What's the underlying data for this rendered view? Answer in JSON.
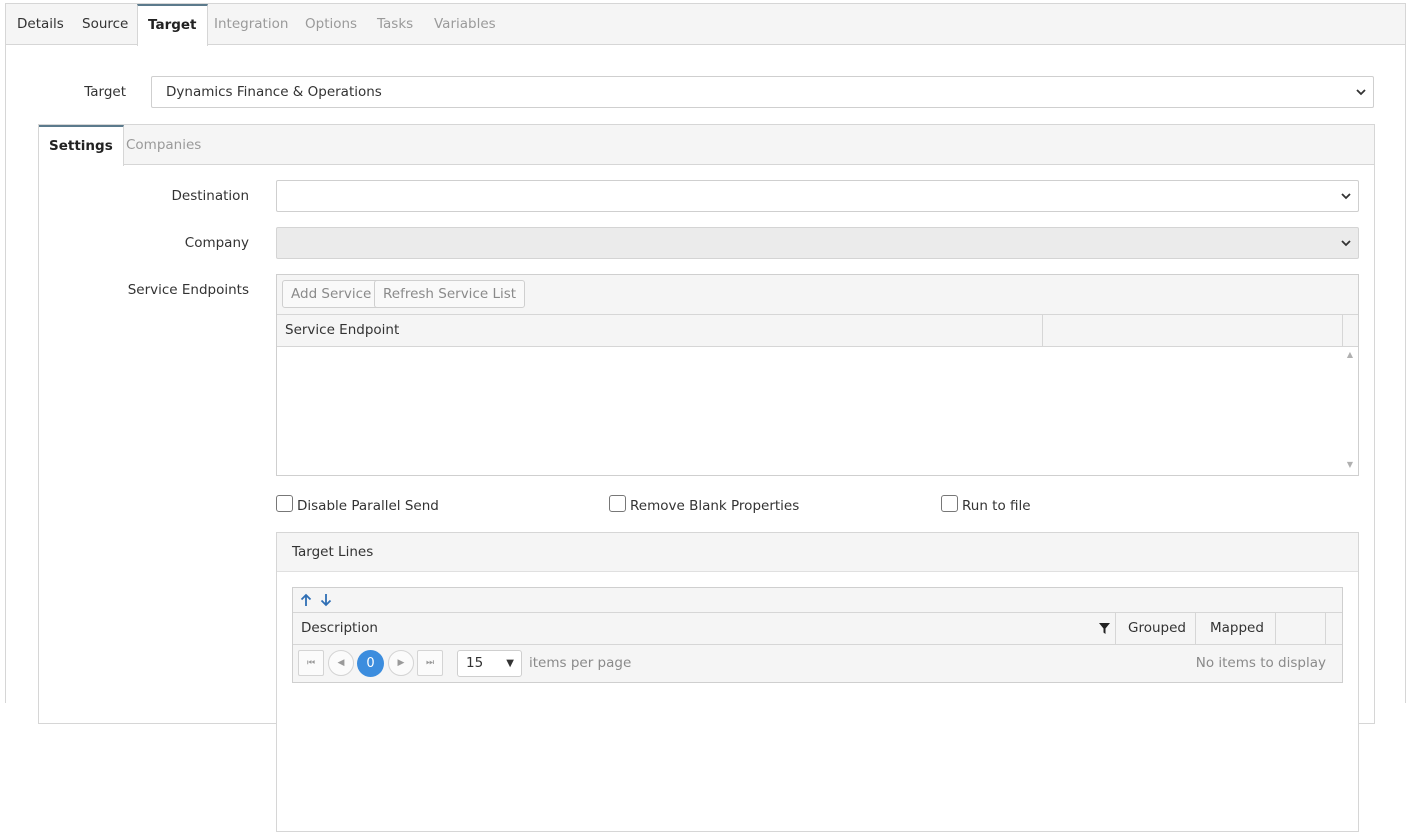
{
  "top_tabs": [
    {
      "label": "Details",
      "state": "normal"
    },
    {
      "label": "Source",
      "state": "normal"
    },
    {
      "label": "Target",
      "state": "active"
    },
    {
      "label": "Integration",
      "state": "muted"
    },
    {
      "label": "Options",
      "state": "muted"
    },
    {
      "label": "Tasks",
      "state": "muted"
    },
    {
      "label": "Variables",
      "state": "muted"
    }
  ],
  "target": {
    "label": "Target",
    "value": "Dynamics Finance & Operations"
  },
  "inner_tabs": [
    {
      "label": "Settings",
      "state": "active"
    },
    {
      "label": "Companies",
      "state": "muted"
    }
  ],
  "destination": {
    "label": "Destination",
    "value": ""
  },
  "company": {
    "label": "Company",
    "value": ""
  },
  "service_endpoints": {
    "label": "Service Endpoints",
    "add_button": "Add Service",
    "refresh_button": "Refresh Service List",
    "columns": [
      "Service Endpoint",
      ""
    ]
  },
  "options": {
    "disable_parallel_send": {
      "label": "Disable Parallel Send",
      "checked": false
    },
    "remove_blank_properties": {
      "label": "Remove Blank Properties",
      "checked": false
    },
    "run_to_file": {
      "label": "Run to file",
      "checked": false
    }
  },
  "target_lines": {
    "title": "Target Lines",
    "columns": {
      "description": "Description",
      "grouped": "Grouped",
      "mapped": "Mapped"
    },
    "pager": {
      "current_page": "0",
      "page_size": "15",
      "per_page_label": "items per page",
      "empty_message": "No items to display"
    }
  },
  "colors": {
    "accent": "#3c8dde",
    "tab_indicator": "#5b7a8c",
    "muted_text": "#9a9a9a"
  }
}
